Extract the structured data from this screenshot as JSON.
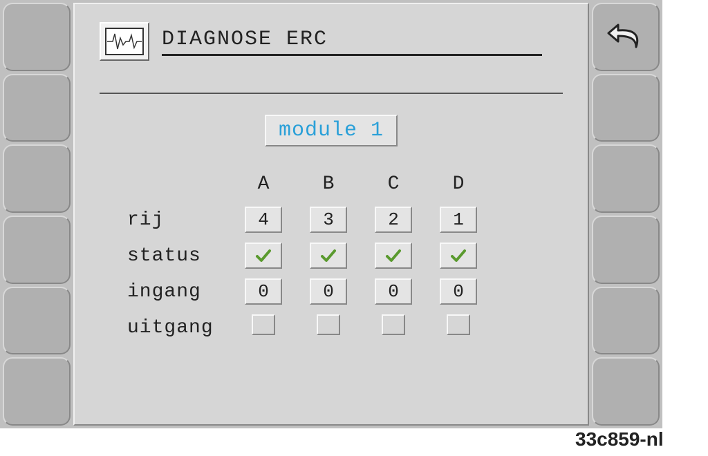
{
  "header": {
    "title": "DIAGNOSE ERC",
    "icon": "waveform-icon"
  },
  "module": {
    "label": "module 1"
  },
  "columns": [
    "A",
    "B",
    "C",
    "D"
  ],
  "rows": {
    "rij": {
      "label": "rij",
      "values": [
        "4",
        "3",
        "2",
        "1"
      ]
    },
    "status": {
      "label": "status",
      "values": [
        "ok",
        "ok",
        "ok",
        "ok"
      ]
    },
    "ingang": {
      "label": "ingang",
      "values": [
        "0",
        "0",
        "0",
        "0"
      ]
    },
    "uitgang": {
      "label": "uitgang",
      "values": [
        "",
        "",
        "",
        ""
      ]
    }
  },
  "softkeys": {
    "right_top": "back-icon"
  },
  "footer": {
    "image_id": "33c859-nl"
  }
}
